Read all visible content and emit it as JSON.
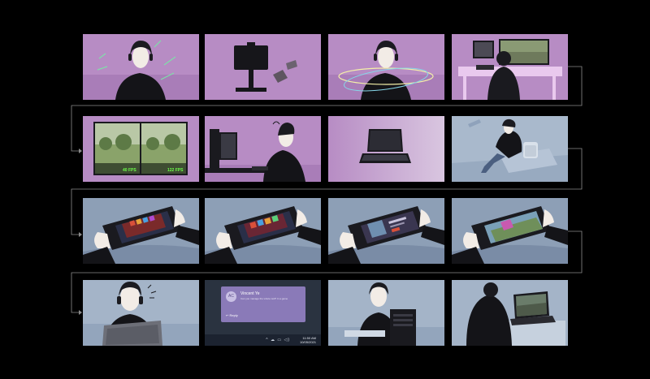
{
  "storyboard": {
    "background": "#000000",
    "connector_color": "#8c8c8c",
    "rows": [
      {
        "row": 1,
        "panels": [
          {
            "scene": "person-with-headset-excited",
            "bg": "#b78cc4"
          },
          {
            "scene": "monitor-on-stand",
            "bg": "#b78cc4"
          },
          {
            "scene": "person-with-headset-swirls",
            "bg": "#b78cc4"
          },
          {
            "scene": "gaming-desk-setup",
            "bg": "#b78cc4"
          }
        ]
      },
      {
        "row": 2,
        "panels": [
          {
            "scene": "fps-comparison",
            "bg": "#b78cc4",
            "fps_left": "40 FPS",
            "fps_right": "122 FPS"
          },
          {
            "scene": "person-at-desktop-pc",
            "bg": "#b78cc4"
          },
          {
            "scene": "laptop-closeup",
            "bg": "#b78cc4"
          },
          {
            "scene": "person-on-couch-with-backpack",
            "bg": "#a9b9cc"
          }
        ]
      },
      {
        "row": 3,
        "panels": [
          {
            "scene": "handheld-console-menu-red",
            "bg": "#8d9fb6"
          },
          {
            "scene": "handheld-console-menu-red",
            "bg": "#8d9fb6"
          },
          {
            "scene": "handheld-console-store",
            "bg": "#8d9fb6"
          },
          {
            "scene": "handheld-console-game",
            "bg": "#8d9fb6"
          }
        ]
      },
      {
        "row": 4,
        "panels": [
          {
            "scene": "person-with-laptop-front",
            "bg": "#a4b4c8"
          },
          {
            "scene": "notification",
            "bg": "#2a3340",
            "notification": {
              "avatar_initials": "AC",
              "sender": "Vincent Ye",
              "message": "Can you manage the whole raid? In a game",
              "reply_label": "Reply"
            },
            "taskbar": {
              "icons": "^ ☁ ▭ ◁)",
              "time": "11:50 AM",
              "date": "10/05/2021"
            }
          },
          {
            "scene": "person-with-pc-tower",
            "bg": "#a4b4c8"
          },
          {
            "scene": "person-at-laptop-back",
            "bg": "#a4b4c8"
          }
        ]
      }
    ]
  }
}
